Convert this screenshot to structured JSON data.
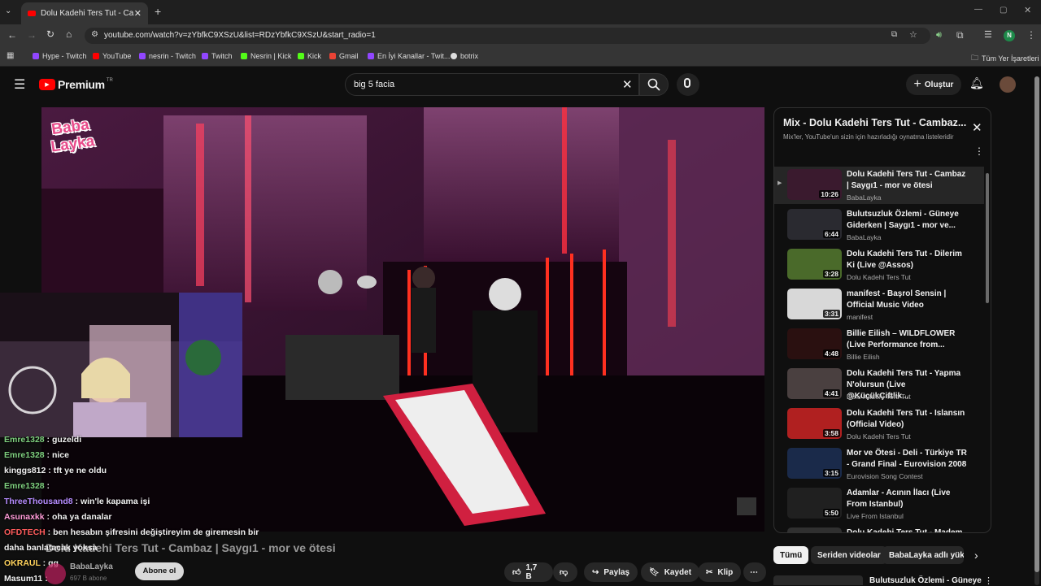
{
  "browser": {
    "tab_title": "Dolu Kadehi Ters Tut - Cambaz",
    "url": "youtube.com/watch?v=zYbfkC9XSzU&list=RDzYbfkC9XSzU&start_radio=1",
    "profile_initial": "N",
    "bookmarks": [
      "Hype - Twitch",
      "YouTube",
      "nesrin - Twitch",
      "Twitch",
      "Nesrin | Kick",
      "Kick",
      "Gmail",
      "En İyi Kanallar - Twit...",
      "botrix"
    ],
    "all_bookmarks": "Tüm Yer İşaretleri"
  },
  "youtube": {
    "logo_text": "Premium",
    "logo_badge": "TR",
    "search_value": "big 5 facia",
    "create_label": "Oluştur"
  },
  "video": {
    "title": "Dolu Kadehi Ters Tut - Cambaz | Saygı1 - mor ve ötesi",
    "channel": "BabaLayka",
    "subs": "697 B abone",
    "subscribe_label": "Abone ol",
    "likes": "1,7 B",
    "share": "Paylaş",
    "save": "Kaydet",
    "clip": "Klip",
    "logo_line1": "Baba",
    "logo_line2": "Layka"
  },
  "chat": [
    {
      "user": "Emre1328",
      "msg": ": guzeldi",
      "color": "#7fd17f"
    },
    {
      "user": "Emre1328",
      "msg": ": nice",
      "color": "#7fd17f"
    },
    {
      "user": "kinggs812",
      "msg": ": tft ye ne oldu",
      "color": "#f1f1f1"
    },
    {
      "user": "Emre1328",
      "msg": ":",
      "color": "#7fd17f"
    },
    {
      "user": "ThreeThousand8",
      "msg": ": win'le kapama işi",
      "color": "#b68cff"
    },
    {
      "user": "Asunaxkk",
      "msg": ": oha ya danalar",
      "color": "#ff9bd8"
    },
    {
      "user": "OFDTECH",
      "msg": ": ben hesabın şifresini değiştireyim de giremesin bir",
      "color": "#ff5c5c"
    },
    {
      "user": "",
      "msg": "daha banlatacak yoksa",
      "color": "#f1f1f1"
    },
    {
      "user": "OKRAUL",
      "msg": ": gg",
      "color": "#ffd25c"
    },
    {
      "user": "Masum11",
      "msg": ":",
      "color": "#f1f1f1"
    }
  ],
  "playlist": {
    "title": "Mix - Dolu Kadehi Ters Tut - Cambaz...",
    "subtitle": "Mix'ler, YouTube'un sizin için hazırladığı oynatma listeleridir",
    "items": [
      {
        "title": "Dolu Kadehi Ters Tut - Cambaz | Saygı1 - mor ve ötesi",
        "channel": "BabaLayka",
        "duration": "10:26",
        "color": "#3a1a2e"
      },
      {
        "title": "Bulutsuzluk Özlemi - Güneye Giderken | Saygı1 - mor ve...",
        "channel": "BabaLayka",
        "duration": "6:44",
        "color": "#2a2a30"
      },
      {
        "title": "Dolu Kadehi Ters Tut - Dilerim Ki (Live @Assos)",
        "channel": "Dolu Kadehi Ters Tut",
        "duration": "3:28",
        "color": "#4a6a2a"
      },
      {
        "title": "manifest - Başrol Sensin | Official Music Video",
        "channel": "manifest",
        "duration": "3:31",
        "color": "#d8d8d8"
      },
      {
        "title": "Billie Eilish – WILDFLOWER (Live Performance from...",
        "channel": "Billie Eilish",
        "duration": "4:48",
        "color": "#2a1010"
      },
      {
        "title": "Dolu Kadehi Ters Tut - Yapma N'olursun (Live @KüçükÇiftlik...",
        "channel": "Dolu Kadehi Ters Tut",
        "duration": "4:41",
        "color": "#4a4040"
      },
      {
        "title": "Dolu Kadehi Ters Tut - Islansın (Official Video)",
        "channel": "Dolu Kadehi Ters Tut",
        "duration": "3:58",
        "color": "#b02020"
      },
      {
        "title": "Mor ve Ötesi - Deli - Türkiye TR - Grand Final - Eurovision 2008",
        "channel": "Eurovision Song Contest",
        "duration": "3:15",
        "color": "#1a2a4a"
      },
      {
        "title": "Adamlar - Acının İlacı (Live From Istanbul)",
        "channel": "Live From Istanbul",
        "duration": "5:50",
        "color": "#202020"
      },
      {
        "title": "Dolu Kadehi Ters Tut - Madem",
        "channel": "",
        "duration": "",
        "color": "#303030"
      }
    ]
  },
  "chips": [
    "Tümü",
    "Seriden videolar",
    "BabaLayka adlı yükle"
  ],
  "next_video": "Bulutsuzluk Özlemi - Güneye"
}
